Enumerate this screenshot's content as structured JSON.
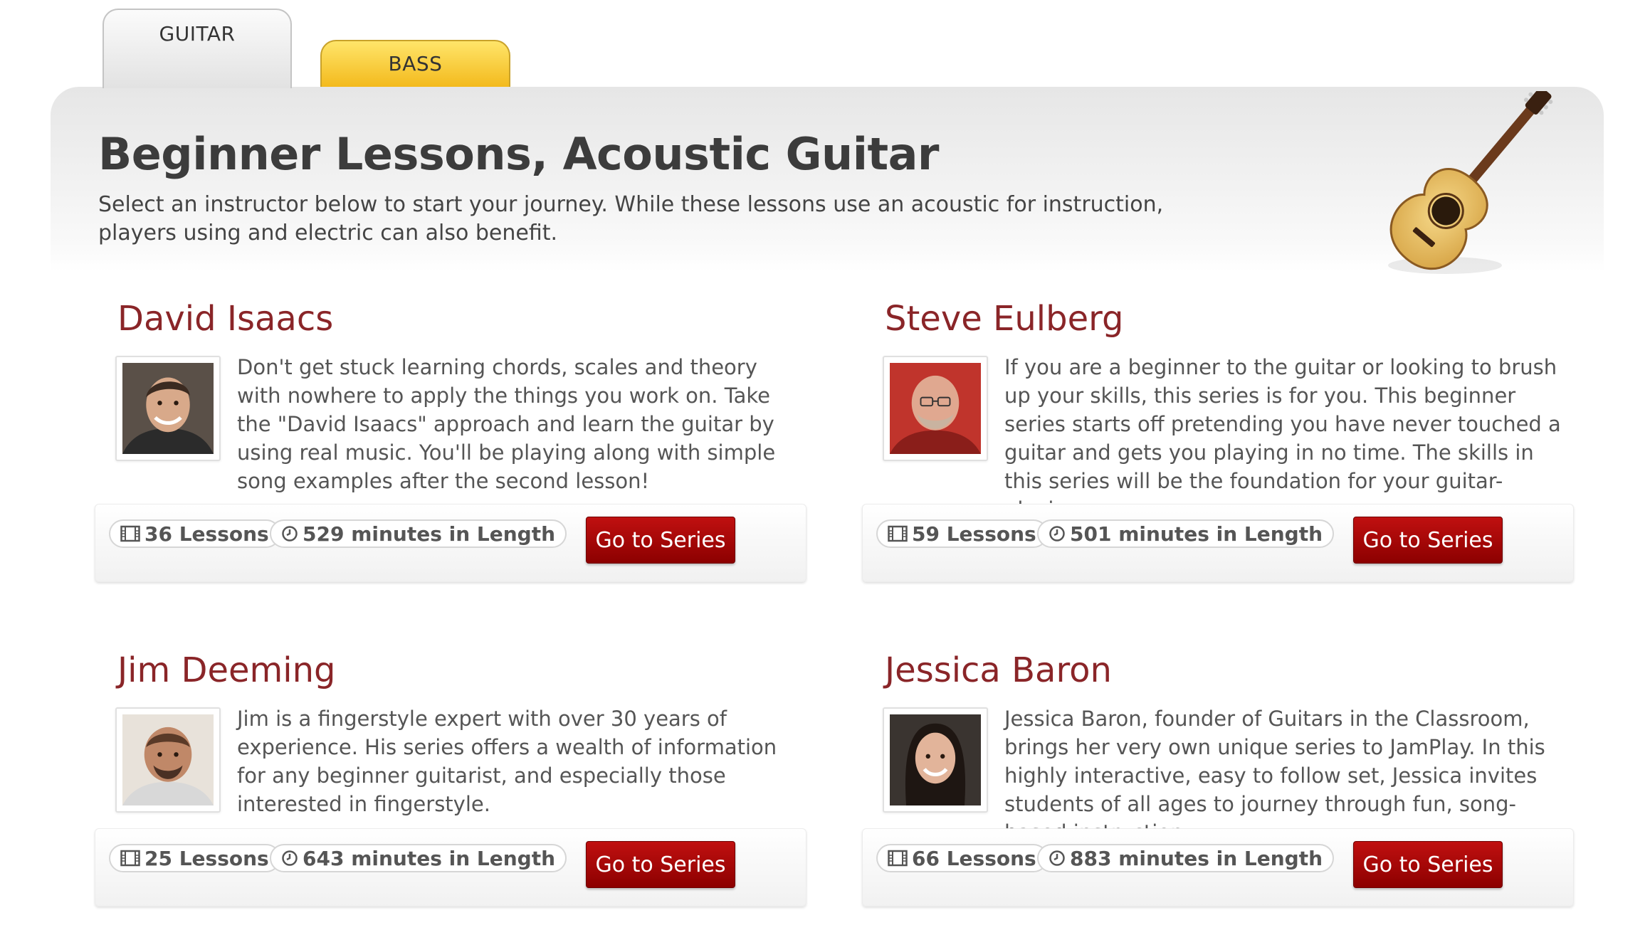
{
  "tabs": [
    {
      "label": "GUITAR",
      "active": true
    },
    {
      "label": "BASS",
      "active": false
    }
  ],
  "header": {
    "title": "Beginner Lessons, Acoustic Guitar",
    "intro": "Select an instructor below to start your journey. While these lessons use an acoustic for instruction, players using and electric can also benefit."
  },
  "instructors": [
    {
      "name": "David Isaacs",
      "description": "Don't get stuck learning chords, scales and theory with nowhere to apply the things you work on. Take the \"David Isaacs\" approach and learn the guitar by using real music. You'll be playing along with simple song examples after the second lesson!",
      "lessons": "36 Lessons",
      "minutes": "529 minutes in Length",
      "button": "Go to Series"
    },
    {
      "name": "Steve Eulberg",
      "description": "If you are a beginner to the guitar or looking to brush up your skills, this series is for you. This beginner series starts off pretending you have never touched a guitar and gets you playing in no time. The skills in this series will be the foundation for your guitar-playing career.",
      "lessons": "59 Lessons",
      "minutes": "501 minutes in Length",
      "button": "Go to Series"
    },
    {
      "name": "Jim Deeming",
      "description": "Jim is a fingerstyle expert with over 30 years of experience. His series offers a wealth of information for any beginner guitarist, and especially those interested in fingerstyle.",
      "lessons": "25 Lessons",
      "minutes": "643 minutes in Length",
      "button": "Go to Series"
    },
    {
      "name": "Jessica Baron",
      "description": "Jessica Baron, founder of Guitars in the Classroom, brings her very own unique series to JamPlay. In this highly interactive, easy to follow set, Jessica invites students of all ages to journey through fun, song-based instruction.",
      "lessons": "66 Lessons",
      "minutes": "883 minutes in Length",
      "button": "Go to Series"
    }
  ],
  "icons": {
    "lessons": "film-icon",
    "minutes": "clock-icon",
    "header_art": "acoustic-guitar-icon"
  },
  "colors": {
    "accent": "#8a2528",
    "button": "#b00000",
    "bass_tab": "#f7cc3a"
  }
}
